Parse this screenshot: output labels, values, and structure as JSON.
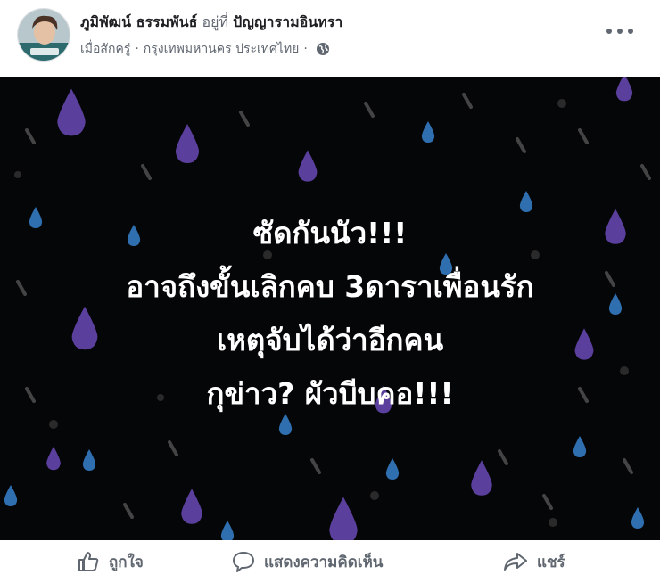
{
  "post": {
    "author_name": "ภูมิพัฒน์ ธรรมพันธ์",
    "at_text": "อยู่ที่",
    "place": "ปัญญารามอินทรา",
    "time": "เมื่อสักครู่",
    "location": "กรุงเทพมหานคร ประเทศไทย",
    "privacy_icon": "globe-icon",
    "more_icon": "more-options-icon"
  },
  "image": {
    "headline_lines": [
      "ซัดกันนัว!!!",
      "อาจถึงขั้นเลิกคบ 3ดาราเพื่อนรัก",
      "เหตุจับได้ว่าอีกคน",
      "กุข่าว? ผัวบีบคอ!!!"
    ],
    "background_color": "#050608",
    "drop_colors": [
      "#5b3f9c",
      "#2f6fb0",
      "#3a3a3a"
    ]
  },
  "actions": {
    "like": "ถูกใจ",
    "comment": "แสดงความคิดเห็น",
    "share": "แชร์"
  },
  "colors": {
    "text_secondary": "#606770",
    "text_primary": "#1c1e21"
  }
}
